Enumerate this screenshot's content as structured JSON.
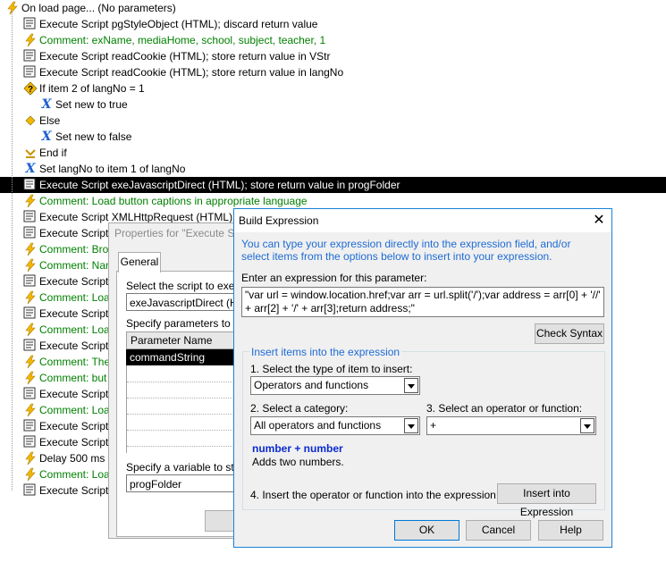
{
  "tree": {
    "rows": [
      {
        "text": "On load page... (No parameters)",
        "icon": "lightning-icon",
        "kind": "event"
      },
      {
        "text": "Execute Script pgStyleObject (HTML); discard return value",
        "icon": "script-icon",
        "kind": "step"
      },
      {
        "text": "Comment: exName, mediaHome, school, subject, teacher, 1",
        "icon": "lightning-icon",
        "kind": "comment"
      },
      {
        "text": "Execute Script readCookie (HTML); store return value in VStr",
        "icon": "script-icon",
        "kind": "step"
      },
      {
        "text": "Execute Script readCookie (HTML); store return value in langNo",
        "icon": "script-icon",
        "kind": "step"
      },
      {
        "text": "If item 2 of langNo = 1",
        "icon": "if-icon",
        "kind": "step"
      },
      {
        "text": "Set new to true",
        "icon": "set-variable-icon",
        "kind": "step"
      },
      {
        "text": "Else",
        "icon": "else-icon",
        "kind": "step"
      },
      {
        "text": "Set new to false",
        "icon": "set-variable-icon",
        "kind": "step"
      },
      {
        "text": "End if",
        "icon": "end-if-icon",
        "kind": "step"
      },
      {
        "text": "Set langNo to item 1 of langNo",
        "icon": "set-variable-icon",
        "kind": "step"
      },
      {
        "text": "Execute Script exeJavascriptDirect (HTML); store return value in progFolder",
        "icon": "script-icon",
        "kind": "selected"
      },
      {
        "text": "Comment: Load button captions in appropriate language",
        "icon": "lightning-icon",
        "kind": "comment"
      },
      {
        "text": "Execute Script XMLHttpRequest (HTML); discard",
        "icon": "script-icon",
        "kind": "step"
      },
      {
        "text": "Execute Script p",
        "icon": "script-icon",
        "kind": "step"
      },
      {
        "text": "Comment: Brows",
        "icon": "lightning-icon",
        "kind": "comment"
      },
      {
        "text": "Comment: Name",
        "icon": "lightning-icon",
        "kind": "comment"
      },
      {
        "text": "Execute Script p",
        "icon": "script-icon",
        "kind": "step"
      },
      {
        "text": "Comment: Load",
        "icon": "lightning-icon",
        "kind": "comment"
      },
      {
        "text": "Execute Script p",
        "icon": "script-icon",
        "kind": "step"
      },
      {
        "text": "Comment: Load",
        "icon": "lightning-icon",
        "kind": "comment"
      },
      {
        "text": "Execute Script p",
        "icon": "script-icon",
        "kind": "step"
      },
      {
        "text": "Comment: The C",
        "icon": "lightning-icon",
        "kind": "comment"
      },
      {
        "text": "Comment: but th",
        "icon": "lightning-icon",
        "kind": "comment"
      },
      {
        "text": "Execute Script p",
        "icon": "script-icon",
        "kind": "step"
      },
      {
        "text": "Comment: Load",
        "icon": "lightning-icon",
        "kind": "comment"
      },
      {
        "text": "Execute Script p",
        "icon": "script-icon",
        "kind": "step"
      },
      {
        "text": "Execute Script p",
        "icon": "script-icon",
        "kind": "step"
      },
      {
        "text": "Delay 500 ms",
        "icon": "lightning-icon",
        "kind": "step"
      },
      {
        "text": "Comment: Load",
        "icon": "lightning-icon",
        "kind": "comment"
      },
      {
        "text": "Execute Script p",
        "icon": "script-icon",
        "kind": "step"
      }
    ]
  },
  "props": {
    "title": "Properties for \"Execute Scr",
    "tab": "General",
    "select_script_label": "Select the script to execut",
    "script_value": "exeJavascriptDirect (HTM",
    "params_label": "Specify parameters to pas",
    "param_header": "Parameter Name",
    "param_row": "commandString",
    "variable_label": "Specify a variable to store",
    "variable_value": "progFolder",
    "ok_label": "O"
  },
  "dialog": {
    "title": "Build Expression",
    "close": "✕",
    "info": "You can type your expression directly into the expression field, and/or select items from the options below to insert into your expression.",
    "expr_label": "Enter an expression for this parameter:",
    "expr_value": "\"var url = window.location.href;var arr = url.split('/');var address = arr[0] + '//' + arr[2] + '/' + arr[3];return address;\"",
    "check_syntax": "Check Syntax",
    "group_title": "Insert items into the expression",
    "step1_label": "1. Select the type of item to insert:",
    "step1_value": "Operators and functions",
    "step2_label": "2. Select a category:",
    "step2_value": "All operators and functions",
    "step3_label": "3. Select an operator or function:",
    "step3_value": "+",
    "func_name": "number + number",
    "func_desc": "Adds two numbers.",
    "step4_label": "4. Insert the operator or function into the expression:",
    "insert_btn": "Insert into Expression",
    "ok": "OK",
    "cancel": "Cancel",
    "help": "Help"
  }
}
